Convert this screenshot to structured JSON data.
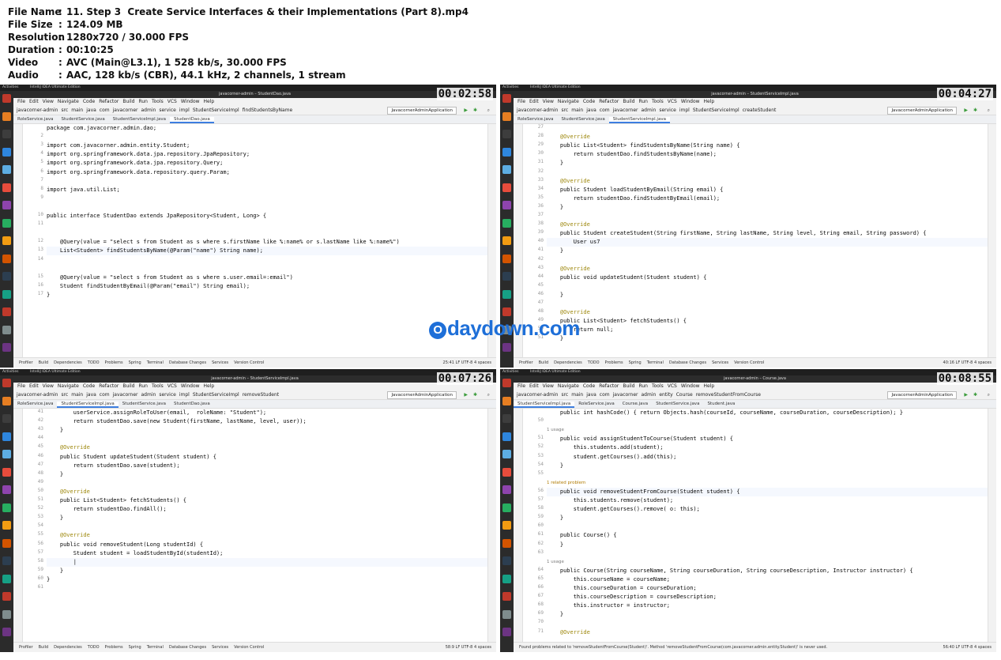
{
  "media_info": [
    {
      "key": "File Name",
      "value": "11. Step 3  Create Service Interfaces & their Implementations (Part 8).mp4"
    },
    {
      "key": "File Size",
      "value": "124.09 MB"
    },
    {
      "key": "Resolution",
      "value": "1280x720 / 30.000 FPS"
    },
    {
      "key": "Duration",
      "value": "00:10:25"
    },
    {
      "key": "Video",
      "value": "AVC (Main@L3.1), 1 528 kb/s, 30.000 FPS"
    },
    {
      "key": "Audio",
      "value": "AAC, 128 kb/s (CBR), 44.1 kHz, 2 channels, 1 stream"
    }
  ],
  "watermark": "daydown.com",
  "menu": [
    "File",
    "Edit",
    "View",
    "Navigate",
    "Code",
    "Refactor",
    "Build",
    "Run",
    "Tools",
    "VCS",
    "Window",
    "Help"
  ],
  "bottom_tools": [
    "Profiler",
    "Build",
    "Dependencies",
    "TODO",
    "Problems",
    "Spring",
    "Terminal",
    "Database Changes",
    "Services",
    "Version Control"
  ],
  "run_config": "JavacornerAdminApplication",
  "screens": [
    {
      "timestamp": "00:02:58",
      "sys_left": "Activities",
      "sys_app": "IntelliJ IDEA Ultimate Edition",
      "window_title": "javacorner-admin – StudentDao.java",
      "breadcrumbs": [
        "javacorner-admin",
        "src",
        "main",
        "java",
        "com",
        "javacorner",
        "admin",
        "service",
        "impl",
        "StudentServiceImpl",
        "findStudentsByName"
      ],
      "tabs": [
        "RoleService.java",
        "StudentService.java",
        "StudentServiceImpl.java",
        "StudentDao.java"
      ],
      "active_tab": 3,
      "cursor_pos": "25:41  LF  UTF-8  4 spaces",
      "status_message": "",
      "lines": [
        {
          "n": "",
          "t": "package com.javacorner.admin.dao;",
          "k": ""
        },
        {
          "n": "2",
          "t": "",
          "k": ""
        },
        {
          "n": "3",
          "t": "import com.javacorner.admin.entity.Student;",
          "k": ""
        },
        {
          "n": "4",
          "t": "import org.springframework.data.jpa.repository.JpaRepository;",
          "k": ""
        },
        {
          "n": "5",
          "t": "import org.springframework.data.jpa.repository.Query;",
          "k": ""
        },
        {
          "n": "6",
          "t": "import org.springframework.data.repository.query.Param;",
          "k": ""
        },
        {
          "n": "7",
          "t": "",
          "k": ""
        },
        {
          "n": "8",
          "t": "import java.util.List;",
          "k": ""
        },
        {
          "n": "9",
          "t": "",
          "k": ""
        },
        {
          "n": "",
          "t": "",
          "k": ""
        },
        {
          "n": "10",
          "t": "public interface StudentDao extends JpaRepository<Student, Long> {",
          "k": ""
        },
        {
          "n": "11",
          "t": "",
          "k": ""
        },
        {
          "n": "",
          "t": "",
          "k": ""
        },
        {
          "n": "12",
          "t": "    @Query(value = \"select s from Student as s where s.firstName like %:name% or s.lastName like %:name%\")",
          "k": ""
        },
        {
          "n": "13",
          "t": "    List<Student> findStudentsByName(@Param(\"name\") String name);",
          "k": "cur"
        },
        {
          "n": "14",
          "t": "",
          "k": ""
        },
        {
          "n": "",
          "t": "",
          "k": ""
        },
        {
          "n": "15",
          "t": "    @Query(value = \"select s from Student as s where s.user.email=:email\")",
          "k": ""
        },
        {
          "n": "16",
          "t": "    Student findStudentByEmail(@Param(\"email\") String email);",
          "k": ""
        },
        {
          "n": "17",
          "t": "}",
          "k": ""
        }
      ]
    },
    {
      "timestamp": "00:04:27",
      "sys_left": "Activities",
      "sys_app": "IntelliJ IDEA Ultimate Edition",
      "window_title": "javacorner-admin – StudentServiceImpl.java",
      "breadcrumbs": [
        "javacorner-admin",
        "src",
        "main",
        "java",
        "com",
        "javacorner",
        "admin",
        "service",
        "impl",
        "StudentServiceImpl",
        "createStudent"
      ],
      "tabs": [
        "RoleService.java",
        "StudentService.java",
        "StudentServiceImpl.java"
      ],
      "active_tab": 2,
      "cursor_pos": "40:16  LF  UTF-8  4 spaces",
      "status_message": "",
      "lines": [
        {
          "n": "27",
          "t": "",
          "k": ""
        },
        {
          "n": "28",
          "t": "    @Override",
          "k": "ann"
        },
        {
          "n": "29",
          "t": "    public List<Student> findStudentsByName(String name) {",
          "k": ""
        },
        {
          "n": "30",
          "t": "        return studentDao.findStudentsByName(name);",
          "k": ""
        },
        {
          "n": "31",
          "t": "    }",
          "k": ""
        },
        {
          "n": "32",
          "t": "",
          "k": ""
        },
        {
          "n": "33",
          "t": "    @Override",
          "k": "ann"
        },
        {
          "n": "34",
          "t": "    public Student loadStudentByEmail(String email) {",
          "k": ""
        },
        {
          "n": "35",
          "t": "        return studentDao.findStudentByEmail(email);",
          "k": ""
        },
        {
          "n": "36",
          "t": "    }",
          "k": ""
        },
        {
          "n": "37",
          "t": "",
          "k": ""
        },
        {
          "n": "38",
          "t": "    @Override",
          "k": "ann"
        },
        {
          "n": "39",
          "t": "    public Student createStudent(String firstName, String lastName, String level, String email, String password) {",
          "k": ""
        },
        {
          "n": "40",
          "t": "        User us7",
          "k": "cur"
        },
        {
          "n": "41",
          "t": "    }",
          "k": ""
        },
        {
          "n": "42",
          "t": "",
          "k": ""
        },
        {
          "n": "43",
          "t": "    @Override",
          "k": "ann"
        },
        {
          "n": "44",
          "t": "    public void updateStudent(Student student) {",
          "k": ""
        },
        {
          "n": "45",
          "t": "",
          "k": ""
        },
        {
          "n": "46",
          "t": "    }",
          "k": ""
        },
        {
          "n": "47",
          "t": "",
          "k": ""
        },
        {
          "n": "48",
          "t": "    @Override",
          "k": "ann"
        },
        {
          "n": "49",
          "t": "    public List<Student> fetchStudents() {",
          "k": ""
        },
        {
          "n": "50",
          "t": "        return null;",
          "k": ""
        },
        {
          "n": "51",
          "t": "    }",
          "k": ""
        }
      ]
    },
    {
      "timestamp": "00:07:26",
      "sys_left": "Activities",
      "sys_app": "IntelliJ IDEA Ultimate Edition",
      "window_title": "javacorner-admin – StudentServiceImpl.java",
      "breadcrumbs": [
        "javacorner-admin",
        "src",
        "main",
        "java",
        "com",
        "javacorner",
        "admin",
        "service",
        "impl",
        "StudentServiceImpl",
        "removeStudent"
      ],
      "tabs": [
        "RoleService.java",
        "StudentServiceImpl.java",
        "StudentService.java",
        "StudentDao.java"
      ],
      "active_tab": 1,
      "cursor_pos": "58:9  LF  UTF-8  4 spaces",
      "status_message": "",
      "lines": [
        {
          "n": "41",
          "t": "        userService.assignRoleToUser(email,  roleName: \"Student\");",
          "k": ""
        },
        {
          "n": "42",
          "t": "        return studentDao.save(new Student(firstName, lastName, level, user));",
          "k": ""
        },
        {
          "n": "43",
          "t": "    }",
          "k": ""
        },
        {
          "n": "44",
          "t": "",
          "k": ""
        },
        {
          "n": "45",
          "t": "    @Override",
          "k": "ann"
        },
        {
          "n": "46",
          "t": "    public Student updateStudent(Student student) {",
          "k": ""
        },
        {
          "n": "47",
          "t": "        return studentDao.save(student);",
          "k": ""
        },
        {
          "n": "48",
          "t": "    }",
          "k": ""
        },
        {
          "n": "49",
          "t": "",
          "k": ""
        },
        {
          "n": "50",
          "t": "    @Override",
          "k": "ann"
        },
        {
          "n": "51",
          "t": "    public List<Student> fetchStudents() {",
          "k": ""
        },
        {
          "n": "52",
          "t": "        return studentDao.findAll();",
          "k": ""
        },
        {
          "n": "53",
          "t": "    }",
          "k": ""
        },
        {
          "n": "54",
          "t": "",
          "k": ""
        },
        {
          "n": "55",
          "t": "    @Override",
          "k": "ann"
        },
        {
          "n": "56",
          "t": "    public void removeStudent(Long studentId) {",
          "k": ""
        },
        {
          "n": "57",
          "t": "        Student student = loadStudentById(studentId);",
          "k": ""
        },
        {
          "n": "58",
          "t": "        |",
          "k": "cur"
        },
        {
          "n": "59",
          "t": "    }",
          "k": ""
        },
        {
          "n": "60",
          "t": "}",
          "k": ""
        },
        {
          "n": "61",
          "t": "",
          "k": ""
        }
      ]
    },
    {
      "timestamp": "00:08:55",
      "sys_left": "Activities",
      "sys_app": "IntelliJ IDEA Ultimate Edition",
      "window_title": "javacorner-admin – Course.java",
      "breadcrumbs": [
        "javacorner-admin",
        "src",
        "main",
        "java",
        "com",
        "javacorner",
        "admin",
        "entity",
        "Course",
        "removeStudentFromCourse"
      ],
      "tabs": [
        "StudentServiceImpl.java",
        "RoleService.java",
        "Course.java",
        "StudentService.java",
        "Student.java"
      ],
      "active_tab": 0,
      "cursor_pos": "56:40  LF  UTF-8  4 spaces",
      "status_message": "Found problems related to 'removeStudentFromCourse(Student)'. Method 'removeStudentFromCourse(com.javacorner.admin.entity.Student)' is never used.",
      "lines": [
        {
          "n": "",
          "t": "    public int hashCode() { return Objects.hash(courseId, courseName, courseDuration, courseDescription); }",
          "k": ""
        },
        {
          "n": "50",
          "t": "",
          "k": ""
        },
        {
          "n": "",
          "t": "1 usage",
          "k": "hint"
        },
        {
          "n": "51",
          "t": "    public void assignStudentToCourse(Student student) {",
          "k": ""
        },
        {
          "n": "52",
          "t": "        this.students.add(student);",
          "k": ""
        },
        {
          "n": "53",
          "t": "        student.getCourses().add(this);",
          "k": ""
        },
        {
          "n": "54",
          "t": "    }",
          "k": ""
        },
        {
          "n": "55",
          "t": "",
          "k": ""
        },
        {
          "n": "",
          "t": "1 related problem",
          "k": "hint warn"
        },
        {
          "n": "56",
          "t": "    public void removeStudentFromCourse(Student student) {",
          "k": "cur"
        },
        {
          "n": "57",
          "t": "        this.students.remove(student);",
          "k": ""
        },
        {
          "n": "58",
          "t": "        student.getCourses().remove( o: this);",
          "k": ""
        },
        {
          "n": "59",
          "t": "    }",
          "k": ""
        },
        {
          "n": "60",
          "t": "",
          "k": ""
        },
        {
          "n": "61",
          "t": "    public Course() {",
          "k": ""
        },
        {
          "n": "62",
          "t": "    }",
          "k": ""
        },
        {
          "n": "63",
          "t": "",
          "k": ""
        },
        {
          "n": "",
          "t": "1 usage",
          "k": "hint"
        },
        {
          "n": "64",
          "t": "    public Course(String courseName, String courseDuration, String courseDescription, Instructor instructor) {",
          "k": ""
        },
        {
          "n": "65",
          "t": "        this.courseName = courseName;",
          "k": ""
        },
        {
          "n": "66",
          "t": "        this.courseDuration = courseDuration;",
          "k": ""
        },
        {
          "n": "67",
          "t": "        this.courseDescription = courseDescription;",
          "k": ""
        },
        {
          "n": "68",
          "t": "        this.instructor = instructor;",
          "k": ""
        },
        {
          "n": "69",
          "t": "    }",
          "k": ""
        },
        {
          "n": "70",
          "t": "",
          "k": ""
        },
        {
          "n": "71",
          "t": "    @Override",
          "k": "ann"
        }
      ]
    }
  ]
}
